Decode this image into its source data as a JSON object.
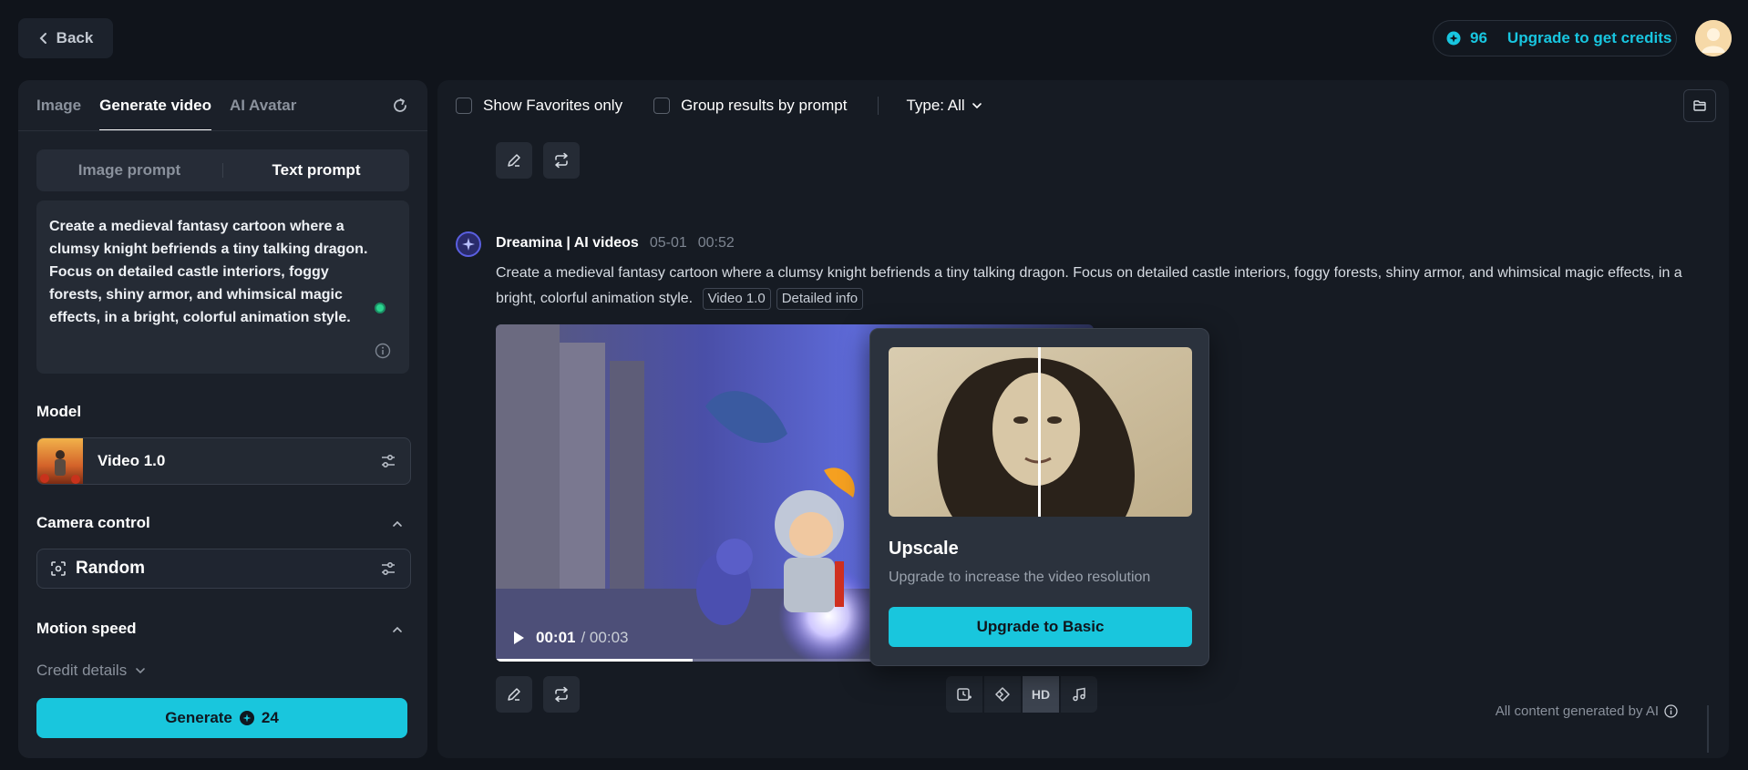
{
  "header": {
    "back_label": "Back",
    "credits": "96",
    "upgrade_label": "Upgrade to get credits"
  },
  "left": {
    "tabs": [
      "Image",
      "Generate video",
      "AI Avatar"
    ],
    "prompt_modes": [
      "Image prompt",
      "Text prompt"
    ],
    "prompt_text": "Create a medieval fantasy cartoon where a clumsy knight befriends a tiny talking dragon. Focus on detailed castle interiors, foggy forests, shiny armor, and whimsical magic effects, in a bright, colorful animation style.",
    "model_label": "Model",
    "model_name": "Video 1.0",
    "camera_label": "Camera control",
    "camera_value": "Random",
    "motion_label": "Motion speed",
    "credit_details": "Credit details",
    "generate_label": "Generate",
    "generate_cost": "24"
  },
  "main": {
    "filters": {
      "favorites": "Show Favorites only",
      "group": "Group results by prompt",
      "type": "Type: All"
    },
    "message": {
      "author": "Dreamina | AI videos",
      "date": "05-01",
      "time": "00:52",
      "text": "Create a medieval fantasy cartoon where a clumsy knight befriends a tiny talking dragon. Focus on detailed castle interiors, foggy forests, shiny armor, and whimsical magic effects, in a bright, colorful animation style.",
      "tag_model": "Video 1.0",
      "tag_info": "Detailed info"
    },
    "video": {
      "current": "00:01",
      "total": "/ 00:03",
      "progress": 0.33
    },
    "hd_label": "HD",
    "footnote": "All content generated by AI"
  },
  "popup": {
    "title": "Upscale",
    "desc": "Upgrade to increase the video resolution",
    "button": "Upgrade to Basic"
  },
  "colors": {
    "accent": "#19c6dd",
    "background": "#10141b",
    "panel": "#1b2029"
  }
}
